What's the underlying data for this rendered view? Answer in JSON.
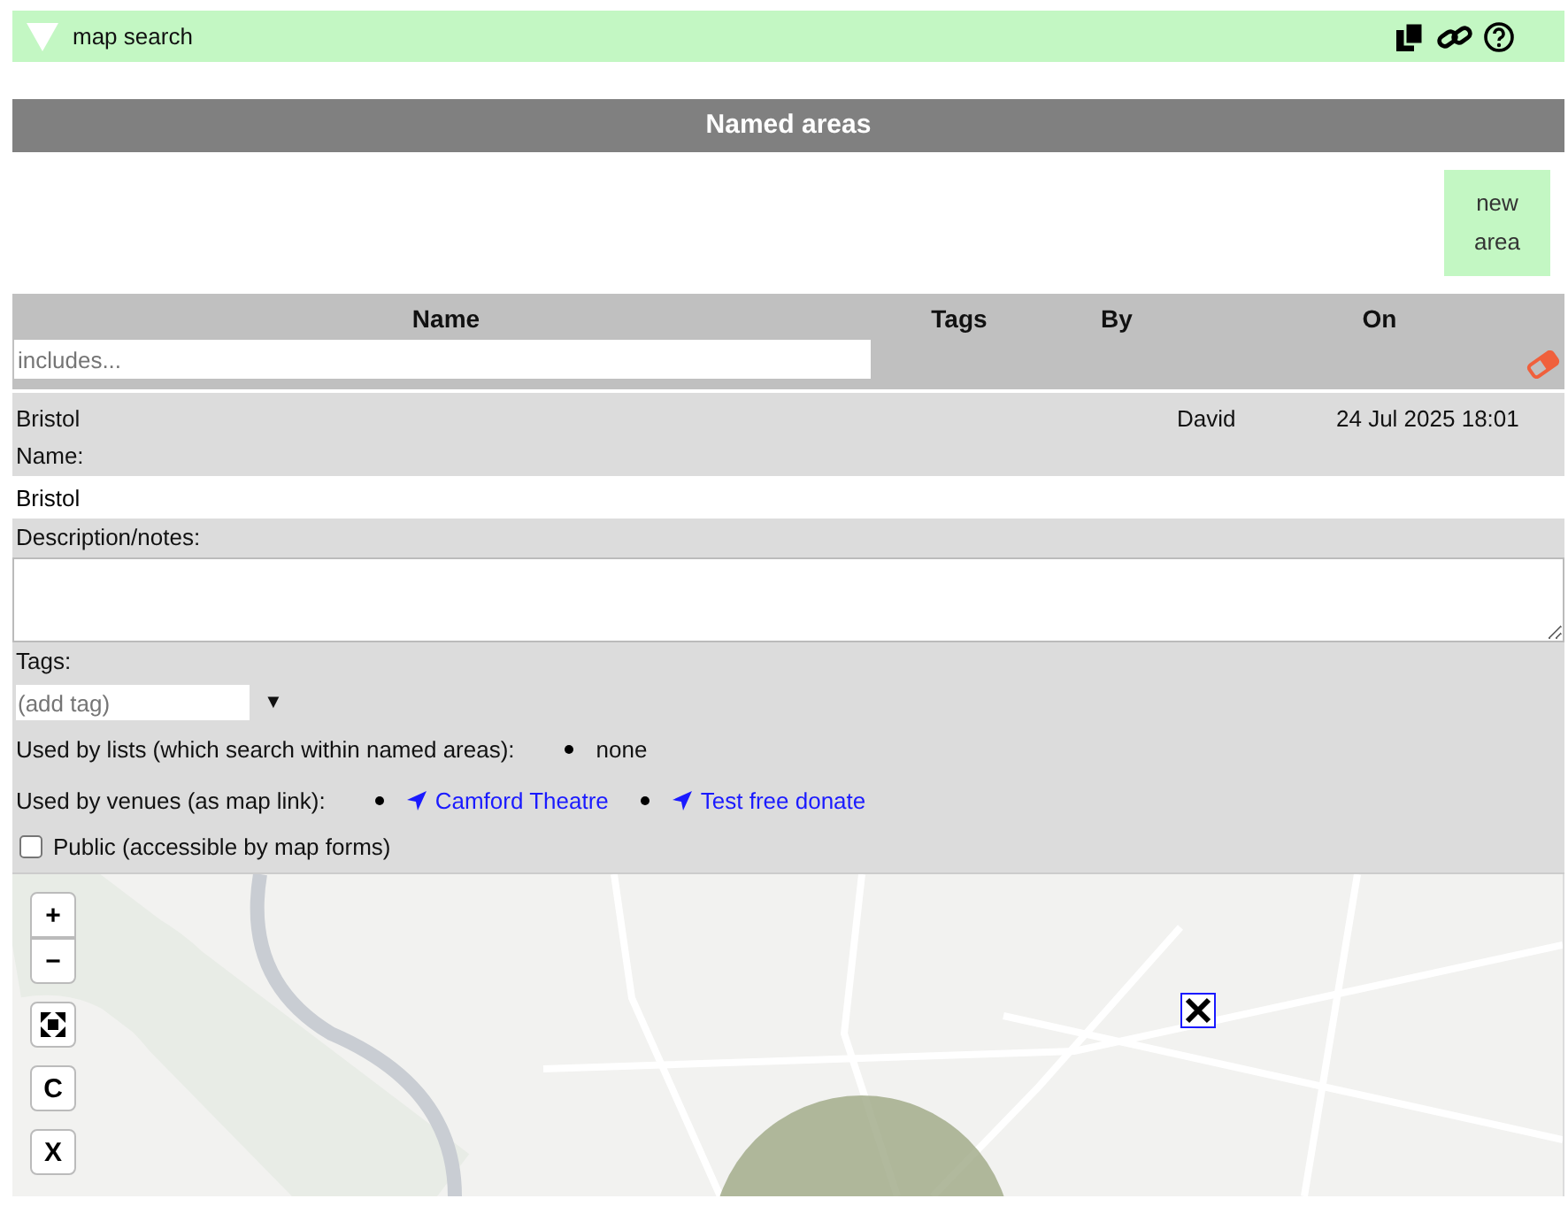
{
  "header": {
    "title": "map search",
    "expanded": true
  },
  "section": {
    "title": "Named areas",
    "new_button": "new\narea"
  },
  "table": {
    "columns": [
      "Name",
      "Tags",
      "By",
      "On"
    ],
    "filter": {
      "placeholder": "includes..."
    },
    "rows": [
      {
        "name": "Bristol",
        "tags": "",
        "by": "David",
        "on": "24 Jul 2025 18:01"
      }
    ]
  },
  "editor": {
    "name_label": "Name:",
    "name_value": "Bristol",
    "description_label": "Description/notes:",
    "tags_label": "Tags:",
    "tags_placeholder": "(add tag)",
    "tags_caret": "▼",
    "used_lists_label": "Used by lists (which search within named areas):",
    "used_lists": [
      {
        "text": "none",
        "link": false
      }
    ],
    "used_venues_label": "Used by venues (as map link):",
    "used_venues": [
      {
        "text": "Camford Theatre",
        "link": true
      },
      {
        "text": "Test free donate",
        "link": true
      }
    ],
    "public_label": "Public (accessible by map forms)",
    "public_checked": false
  },
  "map": {
    "controls": [
      {
        "kind": "text",
        "label": "+"
      },
      {
        "kind": "text",
        "label": "−"
      },
      {
        "kind": "icon"
      },
      {
        "kind": "text",
        "label": "C"
      },
      {
        "kind": "text",
        "label": "X"
      }
    ]
  }
}
